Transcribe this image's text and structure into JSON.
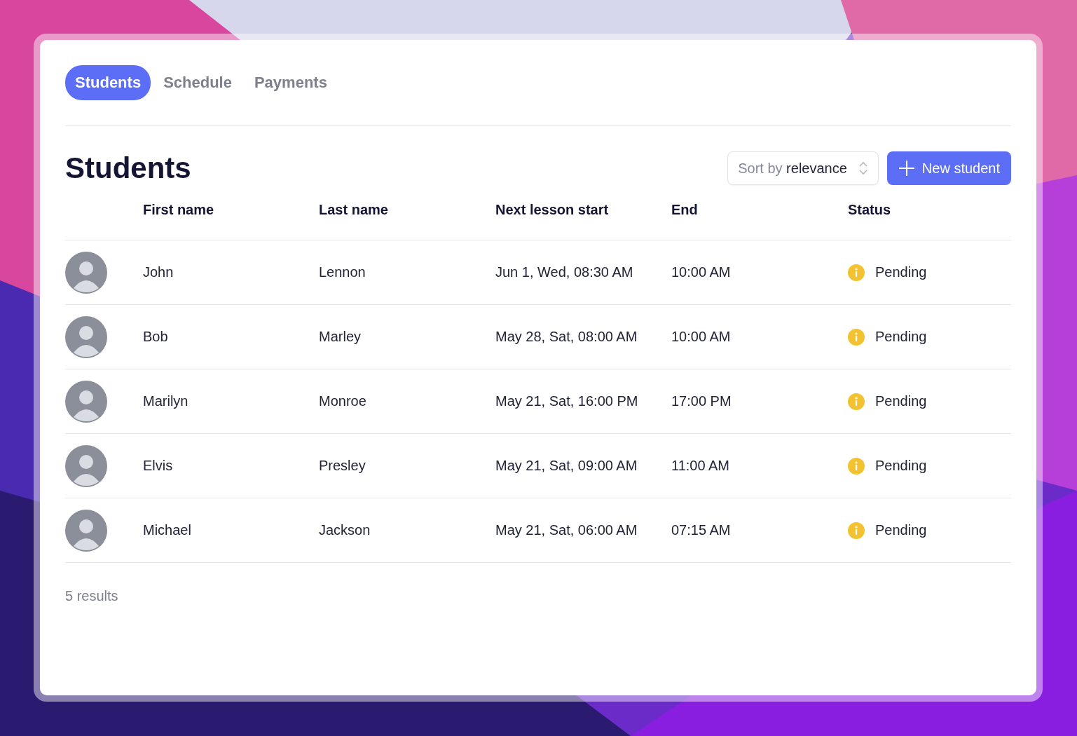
{
  "tabs": [
    {
      "label": "Students",
      "selected": true
    },
    {
      "label": "Schedule",
      "selected": false
    },
    {
      "label": "Payments",
      "selected": false
    }
  ],
  "heading": "Students",
  "sort": {
    "prefix": "Sort by",
    "value": "relevance"
  },
  "new_button": "New student",
  "table": {
    "columns": [
      "First name",
      "Last name",
      "Next lesson start",
      "End",
      "Status"
    ],
    "rows": [
      {
        "first": "John",
        "last": "Lennon",
        "start": "Jun 1, Wed, 08:30 AM",
        "end": "10:00 AM",
        "status": {
          "kind": "pending",
          "label": "Pending"
        }
      },
      {
        "first": "Bob",
        "last": "Marley",
        "start": "May 28, Sat, 08:00 AM",
        "end": "10:00 AM",
        "status": {
          "kind": "pending",
          "label": "Pending"
        }
      },
      {
        "first": "Marilyn",
        "last": "Monroe",
        "start": "May 21, Sat, 16:00 PM",
        "end": "17:00 PM",
        "status": {
          "kind": "pending",
          "label": "Pending"
        }
      },
      {
        "first": "Elvis",
        "last": "Presley",
        "start": "May 21, Sat, 09:00 AM",
        "end": "11:00 AM",
        "status": {
          "kind": "pending",
          "label": "Pending"
        }
      },
      {
        "first": "Michael",
        "last": "Jackson",
        "start": "May 21, Sat, 06:00 AM",
        "end": "07:15 AM",
        "status": {
          "kind": "pending",
          "label": "Pending"
        }
      }
    ]
  },
  "results": "5 results"
}
